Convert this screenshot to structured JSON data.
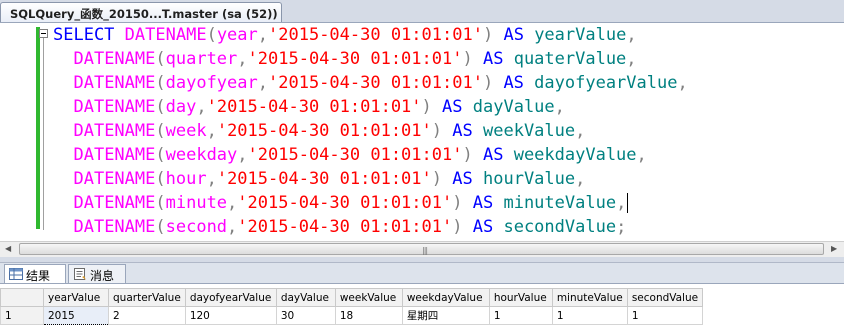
{
  "document_tab": {
    "title": "SQLQuery_函数_20150...T.master (sa (52))"
  },
  "editor": {
    "lines": [
      {
        "keyword_select": "SELECT",
        "func": "DATENAME",
        "open": "(",
        "part": "year",
        "comma": ",",
        "literal": "'2015-04-30 01:01:01'",
        "close": ")",
        "as": "AS",
        "alias": "yearValue",
        "end": ","
      },
      {
        "func": "DATENAME",
        "open": "(",
        "part": "quarter",
        "comma": ",",
        "literal": "'2015-04-30 01:01:01'",
        "close": ")",
        "as": "AS",
        "alias": "quaterValue",
        "end": ","
      },
      {
        "func": "DATENAME",
        "open": "(",
        "part": "dayofyear",
        "comma": ",",
        "literal": "'2015-04-30 01:01:01'",
        "close": ")",
        "as": "AS",
        "alias": "dayofyearValue",
        "end": ","
      },
      {
        "func": "DATENAME",
        "open": "(",
        "part": "day",
        "comma": ",",
        "literal": "'2015-04-30 01:01:01'",
        "close": ")",
        "as": "AS",
        "alias": "dayValue",
        "end": ","
      },
      {
        "func": "DATENAME",
        "open": "(",
        "part": "week",
        "comma": ",",
        "literal": "'2015-04-30 01:01:01'",
        "close": ")",
        "as": "AS",
        "alias": "weekValue",
        "end": ","
      },
      {
        "func": "DATENAME",
        "open": "(",
        "part": "weekday",
        "comma": ",",
        "literal": "'2015-04-30 01:01:01'",
        "close": ")",
        "as": "AS",
        "alias": "weekdayValue",
        "end": ","
      },
      {
        "func": "DATENAME",
        "open": "(",
        "part": "hour",
        "comma": ",",
        "literal": "'2015-04-30 01:01:01'",
        "close": ")",
        "as": "AS",
        "alias": "hourValue",
        "end": ","
      },
      {
        "func": "DATENAME",
        "open": "(",
        "part": "minute",
        "comma": ",",
        "literal": "'2015-04-30 01:01:01'",
        "close": ")",
        "as": "AS",
        "alias": "minuteValue",
        "end": ","
      },
      {
        "func": "DATENAME",
        "open": "(",
        "part": "second",
        "comma": ",",
        "literal": "'2015-04-30 01:01:01'",
        "close": ")",
        "as": "AS",
        "alias": "secondValue",
        "end": ";"
      }
    ]
  },
  "scrollbar": {
    "grip": "|||"
  },
  "result_tabs": {
    "results": "结果",
    "messages": "消息"
  },
  "grid": {
    "columns": [
      "yearValue",
      "quarterValue",
      "dayofyearValue",
      "dayValue",
      "weekValue",
      "weekdayValue",
      "hourValue",
      "minuteValue",
      "secondValue"
    ],
    "rows": [
      {
        "rownum": "1",
        "cells": [
          "2015",
          "2",
          "120",
          "30",
          "18",
          "星期四",
          "1",
          "1",
          "1"
        ]
      }
    ]
  },
  "colors": {
    "keyword": "#0000ff",
    "function": "#ff00ff",
    "string": "#ff0000",
    "identifier": "#008080",
    "operator": "#808080",
    "change_bar": "#2fb82f"
  }
}
